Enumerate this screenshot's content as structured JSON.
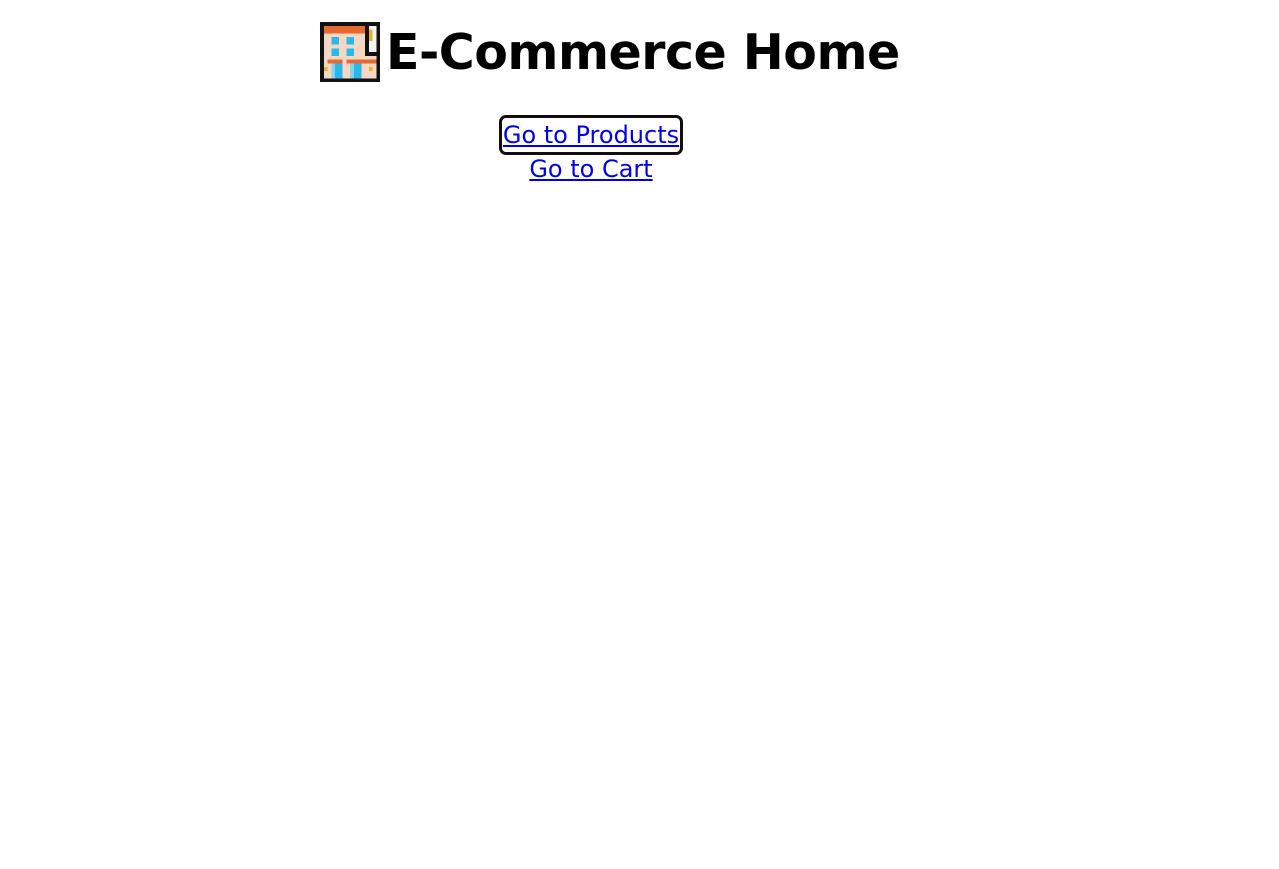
{
  "header": {
    "icon": "convenience-store-icon",
    "title": "E-Commerce Home"
  },
  "nav": {
    "links": [
      {
        "label": "Go to Products",
        "focused": true
      },
      {
        "label": "Go to Cart",
        "focused": false
      }
    ]
  },
  "colors": {
    "link": "#0000ee",
    "title": "#000000",
    "focus_ring": "#101010",
    "background": "#ffffff"
  }
}
